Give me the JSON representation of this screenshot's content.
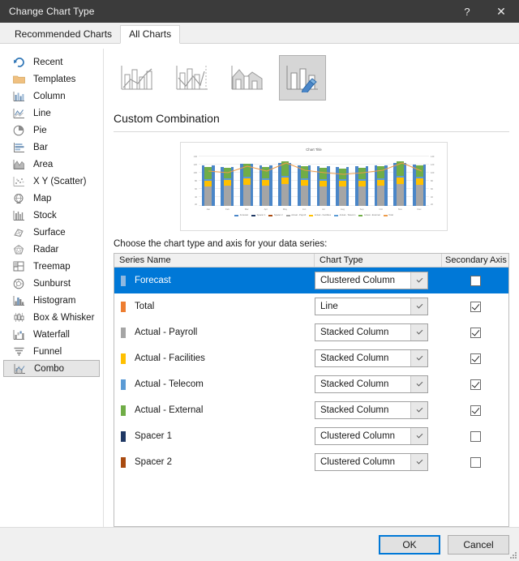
{
  "window": {
    "title": "Change Chart Type",
    "help_label": "?",
    "close_label": "✕",
    "help_icon": "question-mark-icon",
    "close_icon": "close-icon"
  },
  "tabs": [
    {
      "label": "Recommended Charts",
      "active": false
    },
    {
      "label": "All Charts",
      "active": true
    }
  ],
  "sidebar": {
    "items": [
      {
        "label": "Recent",
        "icon": "recent-icon",
        "selected": false
      },
      {
        "label": "Templates",
        "icon": "templates-folder-icon",
        "selected": false
      },
      {
        "label": "Column",
        "icon": "column-chart-icon",
        "selected": false
      },
      {
        "label": "Line",
        "icon": "line-chart-icon",
        "selected": false
      },
      {
        "label": "Pie",
        "icon": "pie-chart-icon",
        "selected": false
      },
      {
        "label": "Bar",
        "icon": "bar-chart-icon",
        "selected": false
      },
      {
        "label": "Area",
        "icon": "area-chart-icon",
        "selected": false
      },
      {
        "label": "X Y (Scatter)",
        "icon": "scatter-chart-icon",
        "selected": false
      },
      {
        "label": "Map",
        "icon": "map-chart-icon",
        "selected": false
      },
      {
        "label": "Stock",
        "icon": "stock-chart-icon",
        "selected": false
      },
      {
        "label": "Surface",
        "icon": "surface-chart-icon",
        "selected": false
      },
      {
        "label": "Radar",
        "icon": "radar-chart-icon",
        "selected": false
      },
      {
        "label": "Treemap",
        "icon": "treemap-chart-icon",
        "selected": false
      },
      {
        "label": "Sunburst",
        "icon": "sunburst-chart-icon",
        "selected": false
      },
      {
        "label": "Histogram",
        "icon": "histogram-chart-icon",
        "selected": false
      },
      {
        "label": "Box & Whisker",
        "icon": "box-whisker-chart-icon",
        "selected": false
      },
      {
        "label": "Waterfall",
        "icon": "waterfall-chart-icon",
        "selected": false
      },
      {
        "label": "Funnel",
        "icon": "funnel-chart-icon",
        "selected": false
      },
      {
        "label": "Combo",
        "icon": "combo-chart-icon",
        "selected": true
      }
    ]
  },
  "combo": {
    "thumbnails": [
      {
        "name": "clustered-column-line-thumbnail",
        "selected": false
      },
      {
        "name": "clustered-column-line-secondary-axis-thumbnail",
        "selected": false
      },
      {
        "name": "stacked-area-clustered-column-thumbnail",
        "selected": false
      },
      {
        "name": "custom-combination-thumbnail",
        "selected": true
      }
    ],
    "heading": "Custom Combination",
    "choose_label": "Choose the chart type and axis for your data series:"
  },
  "preview": {
    "chart_title": "Chart Title"
  },
  "chart_data": {
    "type": "bar",
    "title": "Chart Title",
    "xlabel": "",
    "ylabel": "",
    "grid": true,
    "legend_position": "bottom",
    "categories": [
      "Jan",
      "Feb",
      "Mar",
      "Apr",
      "May",
      "Jun",
      "Jul",
      "Aug",
      "Sep",
      "Oct",
      "Nov",
      "Dec"
    ],
    "series": [
      {
        "name": "Forecast",
        "type": "clustered column",
        "color": "#4a86c8",
        "values": [
          100,
          96,
          104,
          100,
          106,
          100,
          98,
          96,
          98,
          100,
          106,
          102
        ]
      },
      {
        "name": "Spacer 1",
        "type": "clustered column",
        "color": "#1f3864",
        "values": [
          0,
          0,
          0,
          0,
          0,
          0,
          0,
          0,
          0,
          0,
          0,
          0
        ]
      },
      {
        "name": "Spacer 2",
        "type": "clustered column",
        "color": "#a94b10",
        "values": [
          0,
          0,
          0,
          0,
          0,
          0,
          0,
          0,
          0,
          0,
          0,
          0
        ]
      },
      {
        "name": "Actual - Payroll",
        "type": "stacked column",
        "color": "#a5a5a5",
        "values": [
          48,
          50,
          52,
          50,
          54,
          50,
          48,
          48,
          48,
          50,
          54,
          52
        ]
      },
      {
        "name": "Actual - Facilities",
        "type": "stacked column",
        "color": "#ffc000",
        "values": [
          14,
          14,
          16,
          14,
          16,
          14,
          14,
          14,
          14,
          14,
          16,
          16
        ]
      },
      {
        "name": "Actual - Telecom",
        "type": "stacked column",
        "color": "#5b9bd5",
        "values": [
          4,
          4,
          4,
          4,
          4,
          4,
          4,
          4,
          4,
          4,
          4,
          4
        ]
      },
      {
        "name": "Actual - External",
        "type": "stacked column",
        "color": "#70ad47",
        "values": [
          30,
          26,
          32,
          28,
          36,
          30,
          28,
          26,
          28,
          30,
          36,
          28
        ]
      },
      {
        "name": "Total",
        "type": "line",
        "color": "#ed9c4b",
        "values": [
          96,
          94,
          104,
          96,
          110,
          98,
          94,
          92,
          94,
          98,
          110,
          96
        ]
      }
    ]
  },
  "table": {
    "headers": {
      "series_name": "Series Name",
      "chart_type": "Chart Type",
      "secondary_axis": "Secondary Axis"
    },
    "rows": [
      {
        "name": "Forecast",
        "color": "#8fb8e0",
        "chart_type": "Clustered Column",
        "secondary_axis": false,
        "selected": true
      },
      {
        "name": "Total",
        "color": "#ed7d31",
        "chart_type": "Line",
        "secondary_axis": true,
        "selected": false
      },
      {
        "name": "Actual - Payroll",
        "color": "#a5a5a5",
        "chart_type": "Stacked Column",
        "secondary_axis": true,
        "selected": false
      },
      {
        "name": "Actual - Facilities",
        "color": "#ffc000",
        "chart_type": "Stacked Column",
        "secondary_axis": true,
        "selected": false
      },
      {
        "name": "Actual - Telecom",
        "color": "#5b9bd5",
        "chart_type": "Stacked Column",
        "secondary_axis": true,
        "selected": false
      },
      {
        "name": "Actual - External",
        "color": "#70ad47",
        "chart_type": "Stacked Column",
        "secondary_axis": true,
        "selected": false
      },
      {
        "name": "Spacer 1",
        "color": "#1f3864",
        "chart_type": "Clustered Column",
        "secondary_axis": false,
        "selected": false
      },
      {
        "name": "Spacer 2",
        "color": "#a94b10",
        "chart_type": "Clustered Column",
        "secondary_axis": false,
        "selected": false
      }
    ]
  },
  "footer": {
    "ok_label": "OK",
    "cancel_label": "Cancel"
  },
  "colors": {
    "accent": "#0078d7",
    "titlebar": "#3b3b3b",
    "dialog_bg": "#ffffff",
    "footer_bg": "#f0f0f0"
  }
}
